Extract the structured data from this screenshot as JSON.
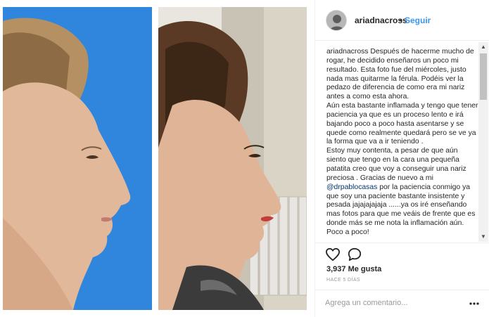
{
  "post": {
    "username": "ariadnacross",
    "separator": "•",
    "follow_label": "Seguir",
    "caption": {
      "user": "ariadnacross",
      "text_before": " Después de hacerme mucho de rogar, he decidido enseñaros un poco mi resultado. Esta foto fue del miércoles, justo nada mas quitarme la férula. Podéis ver la pedazo de diferencia de como era mi nariz antes a como esta ahora.\nAún esta bastante inflamada y tengo que tener paciencia ya que es un proceso lento e irá bajando poco a poco hasta asentarse y se quede como realmente quedará pero se ve ya la forma que va a ir teniendo .\nEstoy muy contenta, a pesar de que aún siento que tengo en la cara una pequeña patatita creo que voy a conseguir una nariz preciosa . Gracias de nuevo a mi ",
      "mention": "@drpablocasas",
      "text_after": " por la paciencia conmigo ya que soy una paciente bastante insistente y pesada jajajajajaja ......ya os iré enseñando mas fotos para que me veáis de frente que es donde más se me nota la inflamación aún. Poco a poco!"
    },
    "likes": "3,937 Me gusta",
    "time_ago": "HACE 5 DÍAS",
    "comment_placeholder": "Agrega un comentario...",
    "colors": {
      "link": "#3897f0",
      "text": "#262626",
      "muted": "#999999",
      "left_photo_background": "#2f86dc"
    },
    "icons": [
      "heart-icon",
      "comment-icon",
      "more-options-icon",
      "scroll-up-icon",
      "scroll-down-icon"
    ]
  }
}
